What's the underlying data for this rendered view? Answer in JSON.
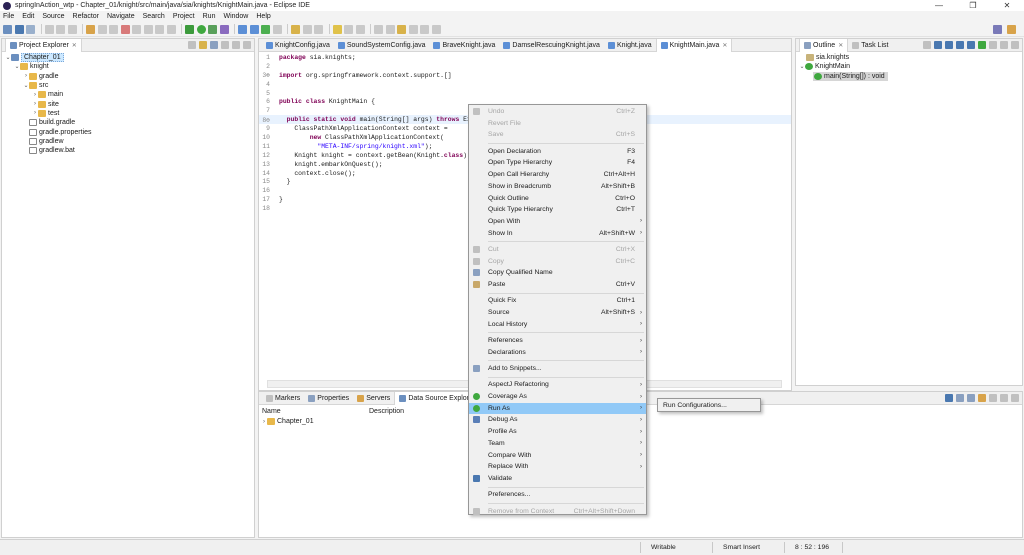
{
  "window": {
    "title": "springInAction_wtp - Chapter_01/knight/src/main/java/sia/knights/KnightMain.java - Eclipse IDE",
    "controls": [
      "—",
      "❐",
      "✕"
    ]
  },
  "menu": [
    "File",
    "Edit",
    "Source",
    "Refactor",
    "Navigate",
    "Search",
    "Project",
    "Run",
    "Window",
    "Help"
  ],
  "project_explorer": {
    "tab": "Project Explorer",
    "tree": [
      {
        "label": "Chapter_01",
        "level": 0,
        "expanded": true,
        "kind": "project",
        "selected": true
      },
      {
        "label": "knight",
        "level": 1,
        "expanded": true,
        "kind": "folder"
      },
      {
        "label": "gradle",
        "level": 2,
        "expanded": false,
        "kind": "folder"
      },
      {
        "label": "src",
        "level": 2,
        "expanded": true,
        "kind": "folder"
      },
      {
        "label": "main",
        "level": 3,
        "expanded": false,
        "kind": "folder"
      },
      {
        "label": "site",
        "level": 3,
        "expanded": false,
        "kind": "folder"
      },
      {
        "label": "test",
        "level": 3,
        "expanded": false,
        "kind": "folder"
      },
      {
        "label": "build.gradle",
        "level": 2,
        "kind": "file"
      },
      {
        "label": "gradle.properties",
        "level": 2,
        "kind": "file"
      },
      {
        "label": "gradlew",
        "level": 2,
        "kind": "file"
      },
      {
        "label": "gradlew.bat",
        "level": 2,
        "kind": "file"
      }
    ]
  },
  "editor": {
    "tabs": [
      "KnightConfig.java",
      "SoundSystemConfig.java",
      "BraveKnight.java",
      "DamselRescuingKnight.java",
      "Knight.java",
      "KnightMain.java"
    ],
    "active_tab": "KnightMain.java",
    "lines": [
      {
        "n": "1",
        "code": "package sia.knights;"
      },
      {
        "n": "2",
        "code": ""
      },
      {
        "n": "3⊕",
        "code": "import org.springframework.context.support.[]"
      },
      {
        "n": "4",
        "code": ""
      },
      {
        "n": "5",
        "code": ""
      },
      {
        "n": "6",
        "code": "public class KnightMain {"
      },
      {
        "n": "7",
        "code": ""
      },
      {
        "n": "8⊖",
        "code": "  public static void main(String[] args) throws Exception {"
      },
      {
        "n": "9",
        "code": "    ClassPathXmlApplicationContext context ="
      },
      {
        "n": "10",
        "code": "        new ClassPathXmlApplicationContext("
      },
      {
        "n": "11",
        "code": "          \"META-INF/spring/knight.xml\");"
      },
      {
        "n": "12",
        "code": "    Knight knight = context.getBean(Knight.class);"
      },
      {
        "n": "13",
        "code": "    knight.embarkOnQuest();"
      },
      {
        "n": "14",
        "code": "    context.close();"
      },
      {
        "n": "15",
        "code": "  }"
      },
      {
        "n": "16",
        "code": ""
      },
      {
        "n": "17",
        "code": "}"
      },
      {
        "n": "18",
        "code": ""
      }
    ]
  },
  "outline": {
    "tabs": [
      "Outline",
      "Task List"
    ],
    "items": [
      {
        "label": "sia.knights",
        "level": 0
      },
      {
        "label": "KnightMain",
        "level": 0
      },
      {
        "label": "main(String[]) : void",
        "level": 1
      }
    ]
  },
  "bottom_panel": {
    "tabs": [
      "Markers",
      "Properties",
      "Servers",
      "Data Source Explorer"
    ],
    "columns": [
      "Name",
      "Description"
    ],
    "rows": [
      "Chapter_01"
    ]
  },
  "context_menu": {
    "items": [
      {
        "label": "Undo",
        "shortcut": "Ctrl+Z",
        "disabled": true
      },
      {
        "label": "Revert File",
        "disabled": true
      },
      {
        "label": "Save",
        "shortcut": "Ctrl+S",
        "disabled": true
      },
      {
        "sep": true
      },
      {
        "label": "Open Declaration",
        "shortcut": "F3"
      },
      {
        "label": "Open Type Hierarchy",
        "shortcut": "F4"
      },
      {
        "label": "Open Call Hierarchy",
        "shortcut": "Ctrl+Alt+H"
      },
      {
        "label": "Show in Breadcrumb",
        "shortcut": "Alt+Shift+B"
      },
      {
        "label": "Quick Outline",
        "shortcut": "Ctrl+O"
      },
      {
        "label": "Quick Type Hierarchy",
        "shortcut": "Ctrl+T"
      },
      {
        "label": "Open With",
        "submenu": true
      },
      {
        "label": "Show In",
        "shortcut": "Alt+Shift+W",
        "submenu": true
      },
      {
        "sep": true
      },
      {
        "label": "Cut",
        "shortcut": "Ctrl+X",
        "disabled": true
      },
      {
        "label": "Copy",
        "shortcut": "Ctrl+C",
        "disabled": true
      },
      {
        "label": "Copy Qualified Name"
      },
      {
        "label": "Paste",
        "shortcut": "Ctrl+V"
      },
      {
        "sep": true
      },
      {
        "label": "Quick Fix",
        "shortcut": "Ctrl+1"
      },
      {
        "label": "Source",
        "shortcut": "Alt+Shift+S",
        "submenu": true
      },
      {
        "label": "Local History",
        "submenu": true
      },
      {
        "sep": true
      },
      {
        "label": "References",
        "submenu": true
      },
      {
        "label": "Declarations",
        "submenu": true
      },
      {
        "sep": true
      },
      {
        "label": "Add to Snippets..."
      },
      {
        "sep": true
      },
      {
        "label": "AspectJ Refactoring",
        "submenu": true
      },
      {
        "label": "Coverage As",
        "submenu": true
      },
      {
        "label": "Run As",
        "submenu": true,
        "highlighted": true
      },
      {
        "label": "Debug As",
        "submenu": true
      },
      {
        "label": "Profile As",
        "submenu": true
      },
      {
        "label": "Team",
        "submenu": true
      },
      {
        "label": "Compare With",
        "submenu": true
      },
      {
        "label": "Replace With",
        "submenu": true
      },
      {
        "label": "Validate"
      },
      {
        "sep": true
      },
      {
        "label": "Preferences..."
      },
      {
        "sep": true
      },
      {
        "label": "Remove from Context",
        "shortcut": "Ctrl+Alt+Shift+Down",
        "disabled": true
      }
    ],
    "submenu_item": "Run Configurations..."
  },
  "status": {
    "mode": "Writable",
    "insert": "Smart Insert",
    "position": "8 : 52 : 196"
  },
  "colors": {
    "accent": "#91c9f7",
    "selection": "#cce8ff",
    "current_line": "#e8f2fe"
  }
}
